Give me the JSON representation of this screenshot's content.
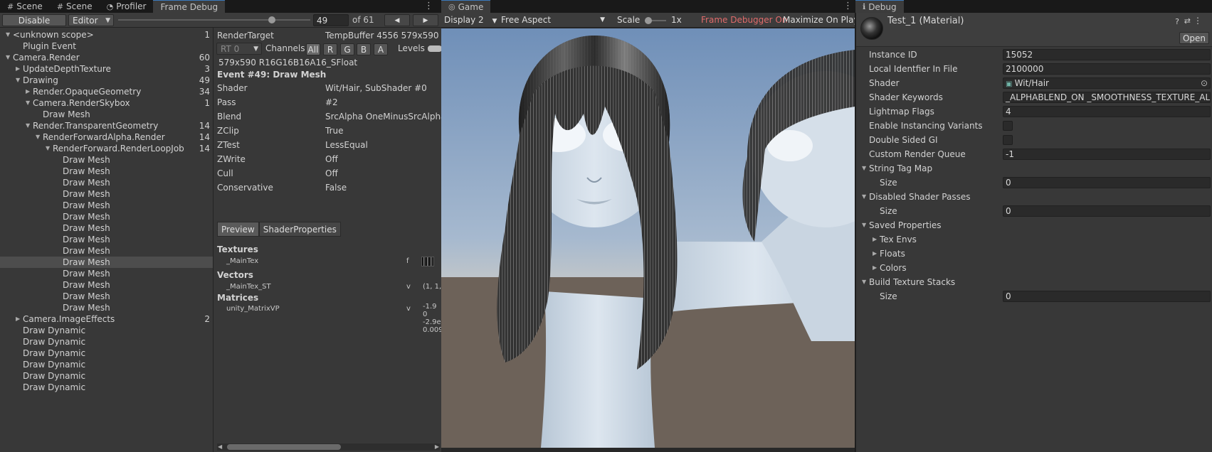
{
  "tabs_left": [
    {
      "icon": "#",
      "label": "Scene"
    },
    {
      "icon": "#",
      "label": "Scene"
    },
    {
      "icon": "◔",
      "label": "Profiler"
    },
    {
      "icon": "",
      "label": "Frame Debug"
    }
  ],
  "tab_game": {
    "icon": "◎",
    "label": "Game"
  },
  "tab_debug": {
    "icon": "ℹ",
    "label": "Debug"
  },
  "fd_toolbar": {
    "disable": "Disable",
    "editor": "Editor",
    "event_index": "49",
    "of_total": "of 61",
    "slider_fraction": 0.8,
    "prev": "◀",
    "next": "▶"
  },
  "tree": [
    {
      "label": "<unknown scope>",
      "count": "1",
      "indent": 0,
      "tw": "down"
    },
    {
      "label": "Plugin Event",
      "count": "",
      "indent": 1,
      "tw": ""
    },
    {
      "label": "Camera.Render",
      "count": "60",
      "indent": 0,
      "tw": "down"
    },
    {
      "label": "UpdateDepthTexture",
      "count": "3",
      "indent": 1,
      "tw": "right"
    },
    {
      "label": "Drawing",
      "count": "49",
      "indent": 1,
      "tw": "down"
    },
    {
      "label": "Render.OpaqueGeometry",
      "count": "34",
      "indent": 2,
      "tw": "right"
    },
    {
      "label": "Camera.RenderSkybox",
      "count": "1",
      "indent": 2,
      "tw": "down"
    },
    {
      "label": "Draw Mesh",
      "count": "",
      "indent": 3,
      "tw": ""
    },
    {
      "label": "Render.TransparentGeometry",
      "count": "14",
      "indent": 2,
      "tw": "down"
    },
    {
      "label": "RenderForwardAlpha.Render",
      "count": "14",
      "indent": 3,
      "tw": "down"
    },
    {
      "label": "RenderForward.RenderLoopJob",
      "count": "14",
      "indent": 4,
      "tw": "down"
    },
    {
      "label": "Draw Mesh",
      "count": "",
      "indent": 5,
      "tw": ""
    },
    {
      "label": "Draw Mesh",
      "count": "",
      "indent": 5,
      "tw": ""
    },
    {
      "label": "Draw Mesh",
      "count": "",
      "indent": 5,
      "tw": ""
    },
    {
      "label": "Draw Mesh",
      "count": "",
      "indent": 5,
      "tw": ""
    },
    {
      "label": "Draw Mesh",
      "count": "",
      "indent": 5,
      "tw": ""
    },
    {
      "label": "Draw Mesh",
      "count": "",
      "indent": 5,
      "tw": ""
    },
    {
      "label": "Draw Mesh",
      "count": "",
      "indent": 5,
      "tw": ""
    },
    {
      "label": "Draw Mesh",
      "count": "",
      "indent": 5,
      "tw": ""
    },
    {
      "label": "Draw Mesh",
      "count": "",
      "indent": 5,
      "tw": ""
    },
    {
      "label": "Draw Mesh",
      "count": "",
      "indent": 5,
      "tw": "",
      "selected": true
    },
    {
      "label": "Draw Mesh",
      "count": "",
      "indent": 5,
      "tw": ""
    },
    {
      "label": "Draw Mesh",
      "count": "",
      "indent": 5,
      "tw": ""
    },
    {
      "label": "Draw Mesh",
      "count": "",
      "indent": 5,
      "tw": ""
    },
    {
      "label": "Draw Mesh",
      "count": "",
      "indent": 5,
      "tw": ""
    },
    {
      "label": "Camera.ImageEffects",
      "count": "2",
      "indent": 1,
      "tw": "right"
    },
    {
      "label": "Draw Dynamic",
      "count": "",
      "indent": 1,
      "tw": ""
    },
    {
      "label": "Draw Dynamic",
      "count": "",
      "indent": 1,
      "tw": ""
    },
    {
      "label": "Draw Dynamic",
      "count": "",
      "indent": 1,
      "tw": ""
    },
    {
      "label": "Draw Dynamic",
      "count": "",
      "indent": 1,
      "tw": ""
    },
    {
      "label": "Draw Dynamic",
      "count": "",
      "indent": 1,
      "tw": ""
    },
    {
      "label": "Draw Dynamic",
      "count": "",
      "indent": 1,
      "tw": ""
    }
  ],
  "details": {
    "render_target_label": "RenderTarget",
    "render_target_value": "TempBuffer 4556 579x590",
    "rt_select": "RT 0",
    "channels_label": "Channels",
    "channels": [
      "All",
      "R",
      "G",
      "B",
      "A"
    ],
    "levels_label": "Levels",
    "format": "579x590 R16G16B16A16_SFloat",
    "event_title": "Event #49: Draw Mesh",
    "props": [
      {
        "k": "Shader",
        "v": "Wit/Hair, SubShader #0"
      },
      {
        "k": "Pass",
        "v": "#2"
      },
      {
        "k": "Blend",
        "v": "SrcAlpha OneMinusSrcAlpha"
      },
      {
        "k": "ZClip",
        "v": "True"
      },
      {
        "k": "ZTest",
        "v": "LessEqual"
      },
      {
        "k": "ZWrite",
        "v": "Off"
      },
      {
        "k": "Cull",
        "v": "Off"
      },
      {
        "k": "Conservative",
        "v": "False"
      }
    ],
    "subtabs": [
      "Preview",
      "ShaderProperties"
    ],
    "textures_h": "Textures",
    "tex_name": "_MainTex",
    "tex_stage": "f",
    "vectors_h": "Vectors",
    "vec_name": "_MainTex_ST",
    "vec_stage": "v",
    "vec_val": "(1, 1,",
    "matrices_h": "Matrices",
    "mat_name": "unity_MatrixVP",
    "mat_stage": "v",
    "mat_vals": [
      "-1.9",
      "0",
      "-2.9e",
      "0.009"
    ]
  },
  "game_toolbar": {
    "display": "Display 2",
    "aspect": "Free Aspect",
    "scale_label": "Scale",
    "scale_val": "1x",
    "fd_on": "Frame Debugger On",
    "maximize": "Maximize On Play"
  },
  "inspector": {
    "title": "Test_1 (Material)",
    "open": "Open",
    "rows": [
      {
        "k": "Instance ID",
        "v": "15052",
        "type": "field",
        "indent": 0
      },
      {
        "k": "Local Identfier In File",
        "v": "2100000",
        "type": "field",
        "indent": 0
      },
      {
        "k": "Shader",
        "v": "Wit/Hair",
        "type": "object",
        "indent": 0
      },
      {
        "k": "Shader Keywords",
        "v": "_ALPHABLEND_ON _SMOOTHNESS_TEXTURE_ALB",
        "type": "field",
        "indent": 0
      },
      {
        "k": "Lightmap Flags",
        "v": "4",
        "type": "field",
        "indent": 0
      },
      {
        "k": "Enable Instancing Variants",
        "v": "",
        "type": "check",
        "indent": 0
      },
      {
        "k": "Double Sided GI",
        "v": "",
        "type": "check",
        "indent": 0
      },
      {
        "k": "Custom Render Queue",
        "v": "-1",
        "type": "field",
        "indent": 0
      },
      {
        "k": "String Tag Map",
        "v": "",
        "type": "fold-open",
        "indent": 0
      },
      {
        "k": "Size",
        "v": "0",
        "type": "field",
        "indent": 1
      },
      {
        "k": "Disabled Shader Passes",
        "v": "",
        "type": "fold-open",
        "indent": 0
      },
      {
        "k": "Size",
        "v": "0",
        "type": "field",
        "indent": 1
      },
      {
        "k": "Saved Properties",
        "v": "",
        "type": "fold-open",
        "indent": 0
      },
      {
        "k": "Tex Envs",
        "v": "",
        "type": "fold-closed",
        "indent": 1
      },
      {
        "k": "Floats",
        "v": "",
        "type": "fold-closed",
        "indent": 1
      },
      {
        "k": "Colors",
        "v": "",
        "type": "fold-closed",
        "indent": 1
      },
      {
        "k": "Build Texture Stacks",
        "v": "",
        "type": "fold-open",
        "indent": 0
      },
      {
        "k": "Size",
        "v": "0",
        "type": "field",
        "indent": 1
      }
    ]
  },
  "colors": {
    "accent": "#3a79bb",
    "fd_on": "#e06b6b"
  }
}
